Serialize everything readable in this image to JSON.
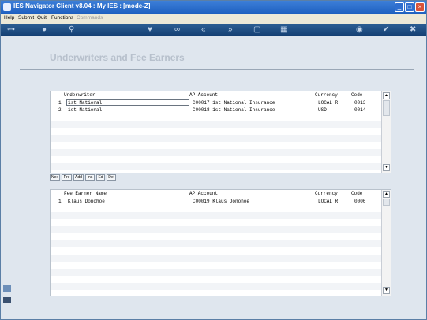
{
  "window": {
    "title": "IES Navigator Client v8.04 : My IES :      [mode-Z]"
  },
  "menu": [
    {
      "label": "Help",
      "enabled": true
    },
    {
      "label": "Submit",
      "enabled": true
    },
    {
      "label": "Quit",
      "enabled": true
    },
    {
      "label": "Functions",
      "enabled": true
    },
    {
      "label": "Commands",
      "enabled": false
    }
  ],
  "page": {
    "title": "Underwriters and Fee Earners"
  },
  "underwriters": {
    "columns": [
      "Underwriter",
      "AP Account",
      "Currency",
      "Code"
    ],
    "rows": [
      {
        "num": "1",
        "underwriter": "1st National",
        "ap_account": "C00017 1st National Insurance",
        "currency": "LOCAL R",
        "code": "0013"
      },
      {
        "num": "2",
        "underwriter": "1st National",
        "ap_account": "C00018 1st National Insurance",
        "currency": "USD",
        "code": "0014"
      }
    ]
  },
  "buttons": [
    "Nex",
    "Pre",
    "Add",
    "Ins",
    "Ed",
    "Del"
  ],
  "fee_earners": {
    "columns": [
      "Fee Earner Name",
      "AP Account",
      "Currency",
      "Code"
    ],
    "rows": [
      {
        "num": "1",
        "name": "Klaus Donohoe",
        "ap_account": "C00019 Klaus Donohoe",
        "currency": "LOCAL R",
        "code": "0006"
      }
    ]
  }
}
